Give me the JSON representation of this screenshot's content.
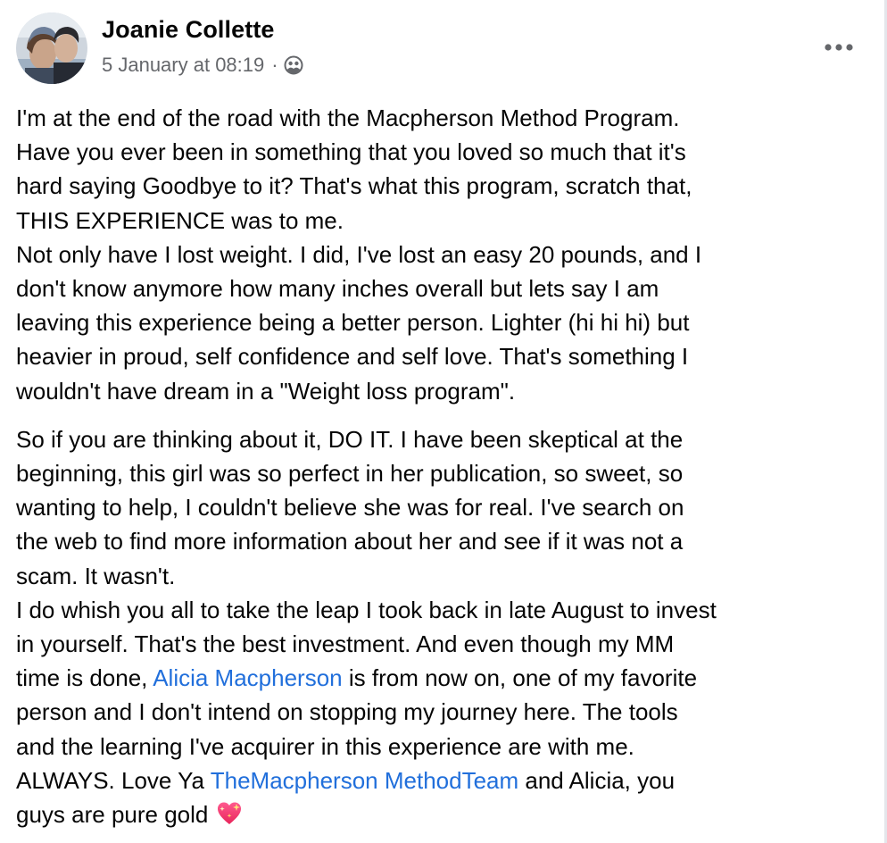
{
  "post": {
    "author": "Joanie Collette",
    "timestamp": "5 January at 08:19",
    "separator": "·",
    "audience_icon": "friends-icon",
    "more_icon": "more-options-icon",
    "colors": {
      "text": "#050505",
      "secondary_text": "#65676b",
      "link": "#216fdb"
    },
    "paragraph1": [
      "I'm at the end of the road with the Macpherson Method Program.",
      "Have you ever been in something that you loved so much that it's",
      "hard saying Goodbye to it? That's what this program, scratch that,",
      "THIS EXPERIENCE was to me.",
      "Not only have I lost weight. I did, I've lost an easy 20 pounds, and I",
      "don't know anymore how many inches overall but lets say I am",
      "leaving this experience being a better person. Lighter (hi hi hi) but",
      "heavier in proud, self confidence and  self love. That's something I",
      "wouldn't have dream in a \"Weight loss program\"."
    ],
    "paragraph2": [
      "So if you are thinking about it, DO IT. I have been skeptical at the",
      "beginning, this girl was so perfect in her publication, so sweet, so",
      "wanting to help, I couldn't believe she was for real. I've search on",
      "the web to find more information about her and see if it was not a",
      "scam. It wasn't.",
      "I do whish you all to take the leap I took back in late August to invest",
      "in yourself. That's the best investment.  And even though my MM"
    ],
    "line_alicia_before": "time is done, ",
    "mention_alicia": "Alicia Macpherson",
    "line_alicia_after": " is from now on, one of my favorite",
    "paragraph2_cont": [
      "person and I don't intend on stopping my journey here. The tools",
      "and the learning I've acquirer in this experience are with me."
    ],
    "line_team_before": "ALWAYS. Love Ya  ",
    "mention_team": "TheMacpherson MethodTeam",
    "line_team_after": " and Alicia, you",
    "last_line": "guys are pure gold ",
    "emoji_icon": "sparkling-heart-emoji"
  }
}
